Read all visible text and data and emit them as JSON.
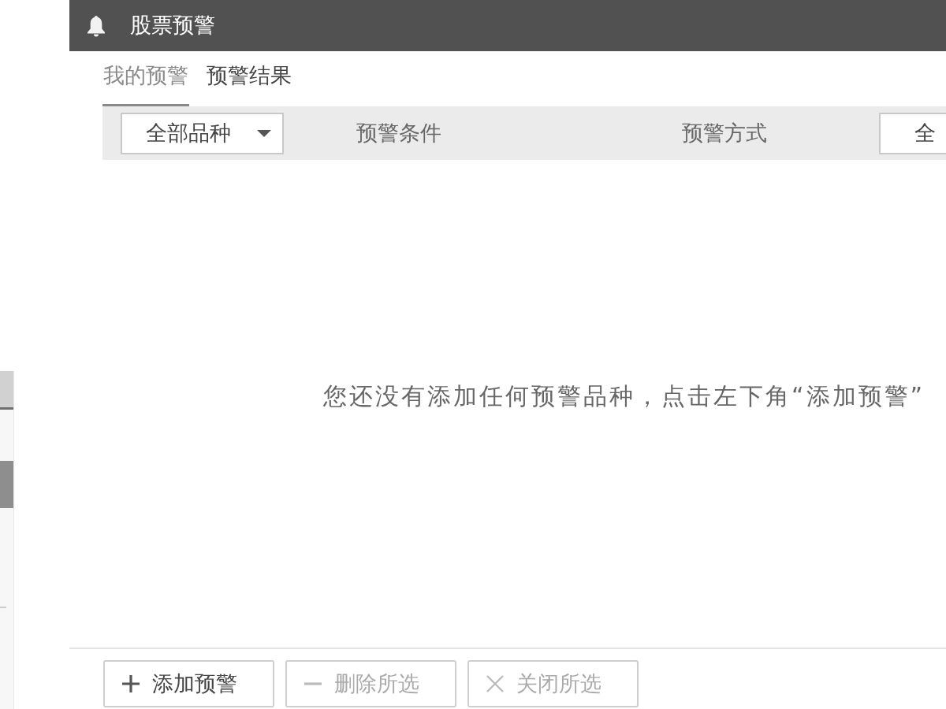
{
  "window": {
    "title": "股票预警"
  },
  "tabs": [
    {
      "label": "我的预警",
      "selected": true
    },
    {
      "label": "预警结果",
      "selected": false
    }
  ],
  "filter_bar": {
    "items": [
      {
        "kind": "dropdown",
        "value": "全部品种"
      },
      {
        "kind": "heading",
        "text": "预警条件"
      },
      {
        "kind": "heading",
        "text": "预警方式"
      },
      {
        "kind": "box",
        "value": "全"
      }
    ]
  },
  "empty_message": "您还没有添加任何预警品种，点击左下角“添加预警”",
  "buttons": [
    {
      "kind": "add",
      "label": "添加预警",
      "disabled": false
    },
    {
      "kind": "delete",
      "label": "删除所选",
      "disabled": true
    },
    {
      "kind": "close",
      "label": "关闭所选",
      "disabled": true
    }
  ]
}
